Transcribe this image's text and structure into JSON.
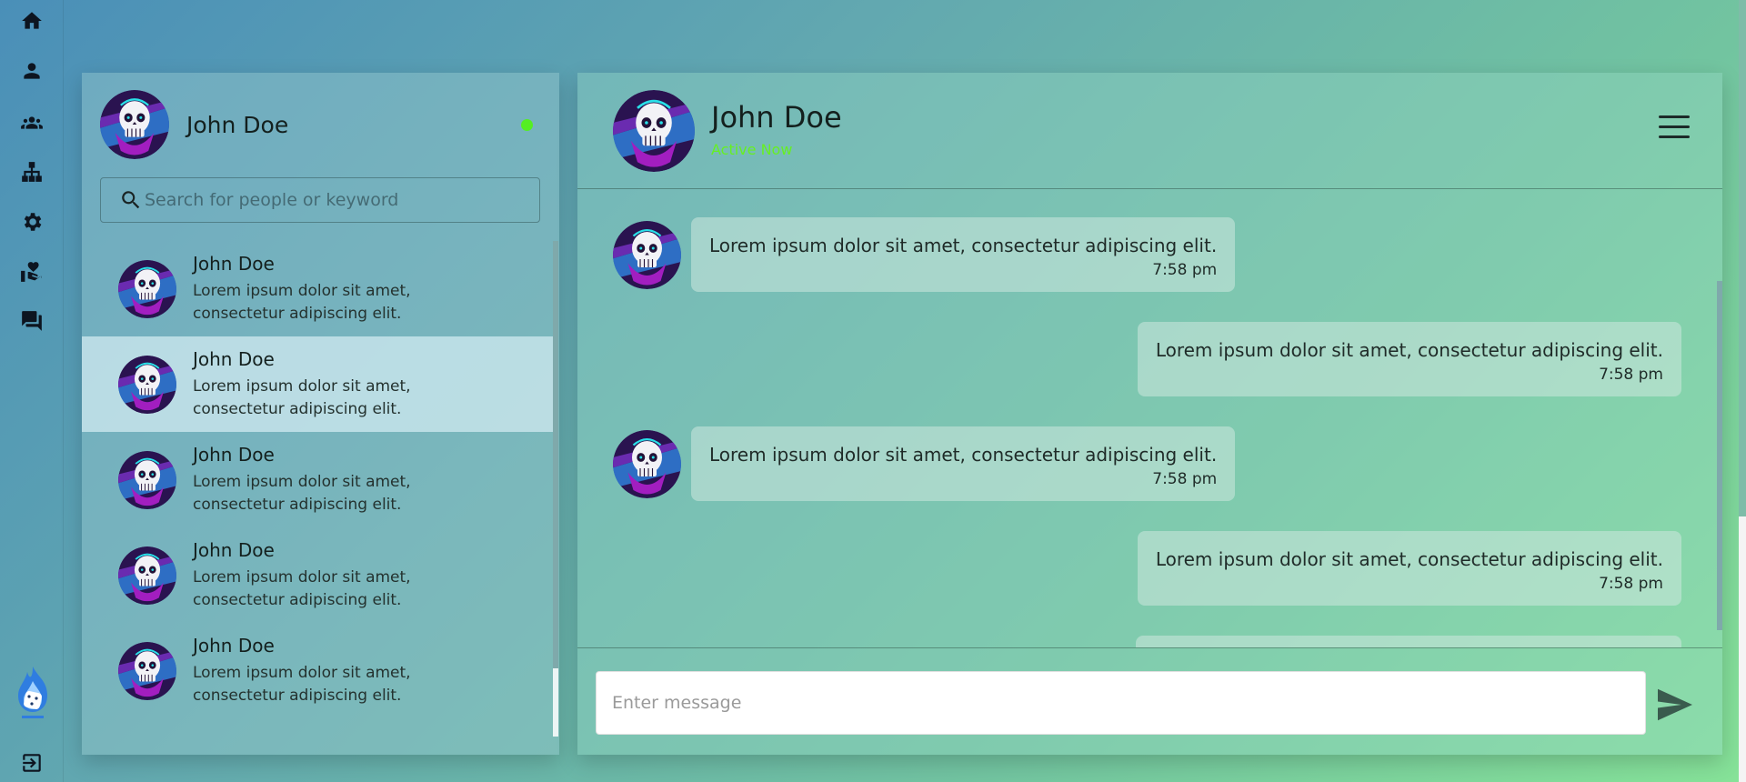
{
  "nav": {
    "items": [
      {
        "name": "home",
        "icon": "home-icon"
      },
      {
        "name": "profile",
        "icon": "person-icon"
      },
      {
        "name": "groups",
        "icon": "people-icon"
      },
      {
        "name": "hierarchy",
        "icon": "sitemap-icon"
      },
      {
        "name": "settings",
        "icon": "gear-icon"
      },
      {
        "name": "donate",
        "icon": "hand-heart-icon"
      },
      {
        "name": "messages",
        "icon": "chat-icon"
      }
    ],
    "logo": "flame-dice-logo",
    "logout_icon": "logout-icon"
  },
  "me": {
    "name": "John Doe",
    "status_color": "#55ee22"
  },
  "search": {
    "placeholder": "Search for people or keyword",
    "value": ""
  },
  "contacts": [
    {
      "name": "John Doe",
      "preview": "Lorem ipsum dolor sit amet, consectetur adipiscing elit.",
      "active": false
    },
    {
      "name": "John Doe",
      "preview": "Lorem ipsum dolor sit amet, consectetur adipiscing elit.",
      "active": true
    },
    {
      "name": "John Doe",
      "preview": "Lorem ipsum dolor sit amet, consectetur adipiscing elit.",
      "active": false
    },
    {
      "name": "John Doe",
      "preview": "Lorem ipsum dolor sit amet, consectetur adipiscing elit.",
      "active": false
    },
    {
      "name": "John Doe",
      "preview": "Lorem ipsum dolor sit amet, consectetur adipiscing elit.",
      "active": false
    }
  ],
  "chat": {
    "name": "John Doe",
    "status": "Active Now",
    "status_color": "#66f022",
    "messages": [
      {
        "side": "received",
        "text": "Lorem ipsum dolor sit amet, consectetur adipiscing elit.",
        "time": "7:58 pm"
      },
      {
        "side": "sent",
        "text": "Lorem ipsum dolor sit amet, consectetur adipiscing elit.",
        "time": "7:58 pm"
      },
      {
        "side": "received",
        "text": "Lorem ipsum dolor sit amet, consectetur adipiscing elit.",
        "time": "7:58 pm"
      },
      {
        "side": "sent",
        "text": "Lorem ipsum dolor sit amet, consectetur adipiscing elit.",
        "time": "7:58 pm"
      }
    ]
  },
  "composer": {
    "placeholder": "Enter message",
    "value": ""
  },
  "colors": {
    "accent_online": "#55ee22",
    "active_contact_bg": "#cde8ee",
    "send_icon": "#3a5b4e"
  }
}
